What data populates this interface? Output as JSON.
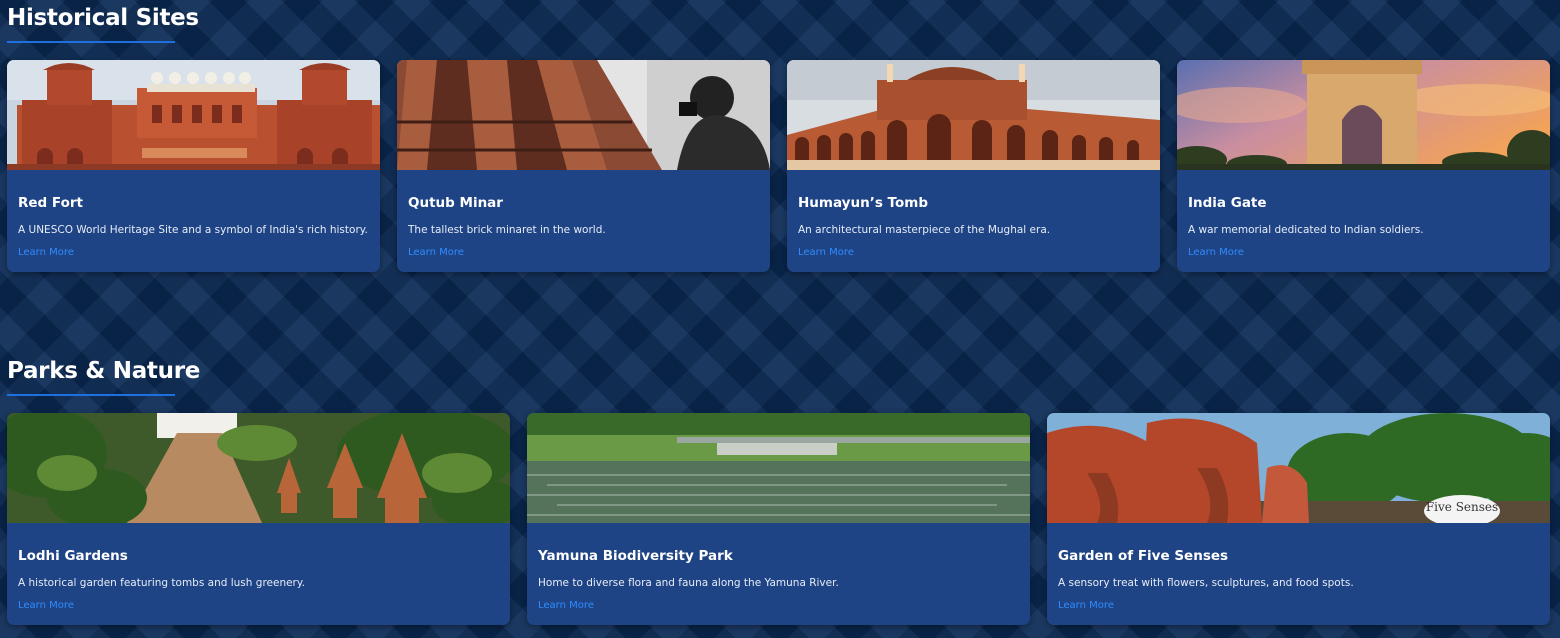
{
  "sections": {
    "historical": {
      "title": "Historical Sites",
      "cards": [
        {
          "title": "Red Fort",
          "description": "A UNESCO World Heritage Site and a symbol of India's rich history.",
          "link": "Learn More"
        },
        {
          "title": "Qutub Minar",
          "description": "The tallest brick minaret in the world.",
          "link": "Learn More"
        },
        {
          "title": "Humayun’s Tomb",
          "description": "An architectural masterpiece of the Mughal era.",
          "link": "Learn More"
        },
        {
          "title": "India Gate",
          "description": "A war memorial dedicated to Indian soldiers.",
          "link": "Learn More"
        }
      ]
    },
    "parks": {
      "title": "Parks & Nature",
      "cards": [
        {
          "title": "Lodhi Gardens",
          "description": "A historical garden featuring tombs and lush greenery.",
          "link": "Learn More"
        },
        {
          "title": "Yamuna Biodiversity Park",
          "description": "Home to diverse flora and fauna along the Yamuna River.",
          "link": "Learn More"
        },
        {
          "title": "Garden of Five Senses",
          "description": "A sensory treat with flowers, sculptures, and food spots.",
          "link": "Learn More",
          "sign_text": "Five Senses"
        }
      ]
    }
  },
  "colors": {
    "page_background": "#0b2a55",
    "card_background": "#1f4485",
    "accent": "#1e6fe0",
    "link": "#2f8cff"
  }
}
